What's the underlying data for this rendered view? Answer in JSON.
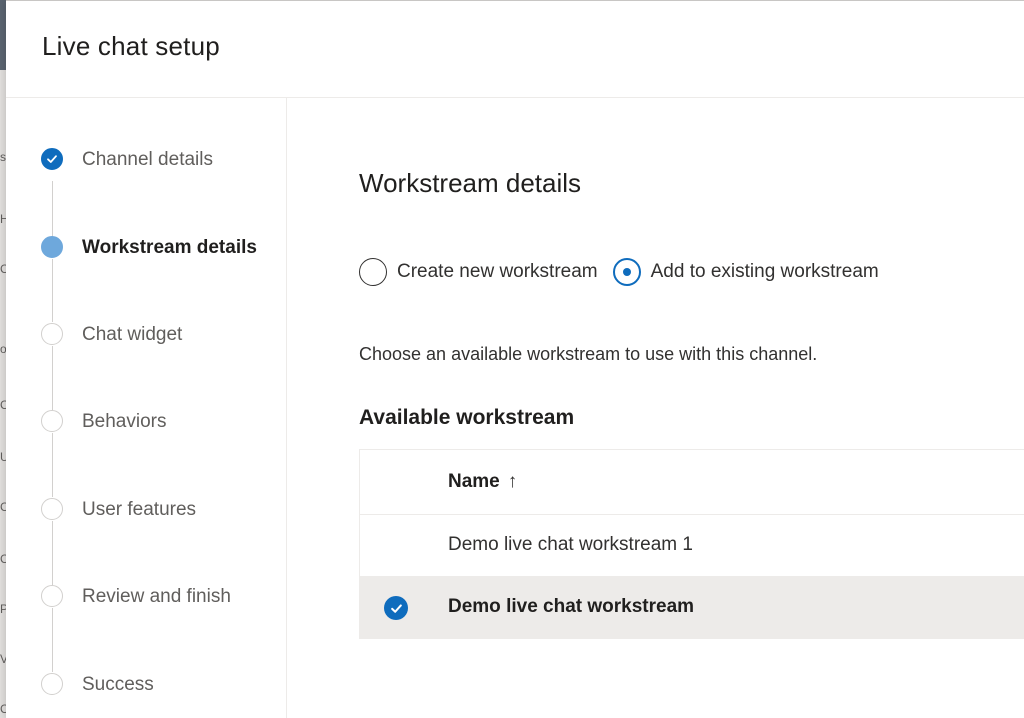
{
  "panel": {
    "title": "Live chat setup"
  },
  "background_fragments": [
    "s",
    "H",
    "C",
    "o",
    "C",
    "U",
    "C",
    "C",
    "P",
    "V",
    "C"
  ],
  "steps": [
    {
      "label": "Channel details",
      "state": "done"
    },
    {
      "label": "Workstream details",
      "state": "active"
    },
    {
      "label": "Chat widget",
      "state": "pending"
    },
    {
      "label": "Behaviors",
      "state": "pending"
    },
    {
      "label": "User features",
      "state": "pending"
    },
    {
      "label": "Review and finish",
      "state": "pending"
    },
    {
      "label": "Success",
      "state": "pending"
    }
  ],
  "content": {
    "title": "Workstream details",
    "options": [
      {
        "label": "Create new workstream",
        "checked": false
      },
      {
        "label": "Add to existing workstream",
        "checked": true
      }
    ],
    "description": "Choose an available workstream to use with this channel.",
    "list_title": "Available workstream",
    "grid": {
      "column": "Name",
      "sort_indicator": "↑",
      "rows": [
        {
          "name": "Demo live chat workstream 1",
          "selected": false
        },
        {
          "name": "Demo live chat workstream",
          "selected": true
        }
      ]
    }
  },
  "colors": {
    "accent": "#0f6cbd",
    "active_step": "#6ea8dc",
    "selected_row": "#edebe9"
  },
  "icons": {
    "step_done": "checkmark-icon",
    "row_selected": "check-circle-icon"
  }
}
